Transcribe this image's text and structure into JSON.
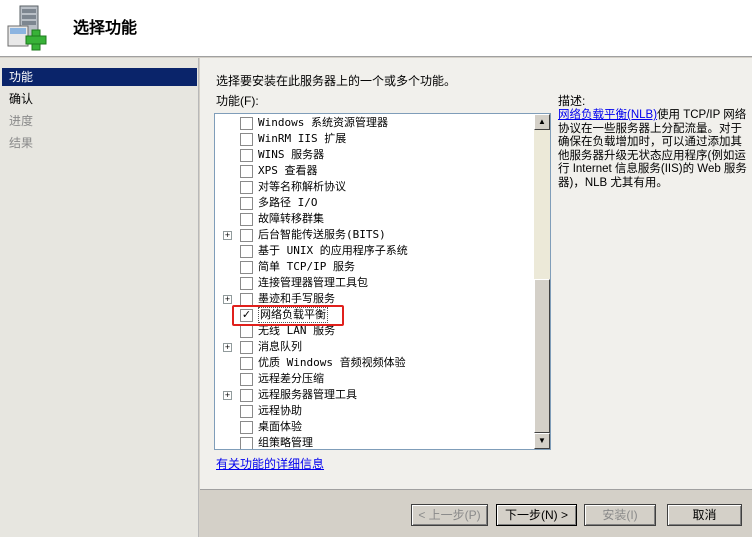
{
  "header": {
    "title": "选择功能",
    "icon": "server-add-icon"
  },
  "nav": {
    "items": [
      {
        "label": "功能",
        "state": "active"
      },
      {
        "label": "确认",
        "state": "normal"
      },
      {
        "label": "进度",
        "state": "disabled"
      },
      {
        "label": "结果",
        "state": "disabled"
      }
    ]
  },
  "main": {
    "intro": "选择要安装在此服务器上的一个或多个功能。",
    "list_label": "功能(F):",
    "features": [
      {
        "label": "Windows 系统资源管理器",
        "expandable": false,
        "checked": false
      },
      {
        "label": "WinRM IIS 扩展",
        "expandable": false,
        "checked": false
      },
      {
        "label": "WINS 服务器",
        "expandable": false,
        "checked": false
      },
      {
        "label": "XPS 查看器",
        "expandable": false,
        "checked": false
      },
      {
        "label": "对等名称解析协议",
        "expandable": false,
        "checked": false
      },
      {
        "label": "多路径 I/O",
        "expandable": false,
        "checked": false
      },
      {
        "label": "故障转移群集",
        "expandable": false,
        "checked": false
      },
      {
        "label": "后台智能传送服务(BITS)",
        "expandable": true,
        "checked": false
      },
      {
        "label": "基于 UNIX 的应用程序子系统",
        "expandable": false,
        "checked": false
      },
      {
        "label": "简单 TCP/IP 服务",
        "expandable": false,
        "checked": false
      },
      {
        "label": "连接管理器管理工具包",
        "expandable": false,
        "checked": false
      },
      {
        "label": "墨迹和手写服务",
        "expandable": true,
        "checked": false
      },
      {
        "label": "网络负载平衡",
        "expandable": false,
        "checked": true,
        "selected": true
      },
      {
        "label": "无线 LAN 服务",
        "expandable": false,
        "checked": false
      },
      {
        "label": "消息队列",
        "expandable": true,
        "checked": false
      },
      {
        "label": "优质 Windows 音频视频体验",
        "expandable": false,
        "checked": false
      },
      {
        "label": "远程差分压缩",
        "expandable": false,
        "checked": false
      },
      {
        "label": "远程服务器管理工具",
        "expandable": true,
        "checked": false
      },
      {
        "label": "远程协助",
        "expandable": false,
        "checked": false
      },
      {
        "label": "桌面体验",
        "expandable": false,
        "checked": false
      },
      {
        "label": "组策略管理",
        "expandable": false,
        "checked": false
      }
    ],
    "more_info_link": "有关功能的详细信息",
    "description": {
      "label": "描述:",
      "link_text": "网络负载平衡(NLB)",
      "text": "使用 TCP/IP 网络协议在一些服务器上分配流量。对于确保在负载增加时，可以通过添加其他服务器升级无状态应用程序(例如运行 Internet 信息服务(IIS)的 Web 服务器)，NLB 尤其有用。"
    }
  },
  "footer": {
    "prev_label": "< 上一步(P)",
    "next_label": "下一步(N) >",
    "install_label": "安装(I)",
    "cancel_label": "取消"
  },
  "colors": {
    "nav_active": "#0a246a",
    "highlight_border": "#e0201c",
    "link": "#0000ee"
  }
}
